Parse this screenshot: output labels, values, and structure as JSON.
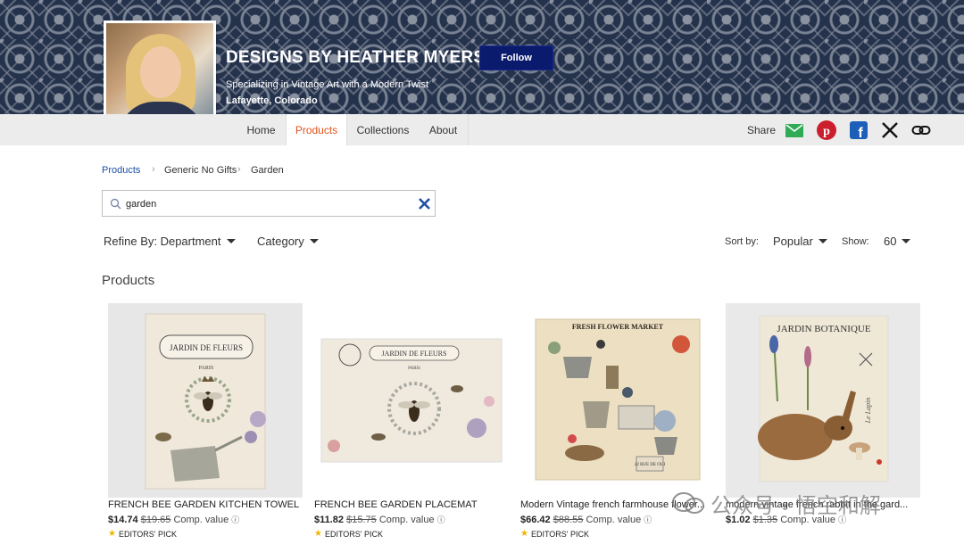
{
  "profile": {
    "shop_name": "DESIGNS BY HEATHER MYERS",
    "follow_label": "Follow",
    "tagline": "Specializing in Vintage Art with a Modern Twist",
    "location": "Lafayette, Colorado"
  },
  "nav": {
    "tabs": [
      {
        "label": "Home"
      },
      {
        "label": "Products"
      },
      {
        "label": "Collections"
      },
      {
        "label": "About"
      }
    ],
    "active": "Products",
    "share_label": "Share"
  },
  "breadcrumb": [
    "Products",
    "Generic No Gifts",
    "Garden"
  ],
  "search": {
    "value": "garden"
  },
  "filters": {
    "refine": "Refine By: Department",
    "category": "Category",
    "sort_label": "Sort by:",
    "sort_value": "Popular",
    "show_label": "Show:",
    "show_value": "60"
  },
  "section_title": "Products",
  "products": [
    {
      "title": "FRENCH BEE GARDEN KITCHEN TOWEL",
      "price": "$14.74",
      "old_price": "$19.65",
      "comp": "Comp. value",
      "badge": "EDITORS' PICK",
      "art_title": "JARDIN DE FLEURS",
      "art_sub": "PARIS"
    },
    {
      "title": "FRENCH BEE GARDEN PLACEMAT",
      "price": "$11.82",
      "old_price": "$15.75",
      "comp": "Comp. value",
      "badge": "EDITORS' PICK",
      "art_title": "JARDIN DE FLEURS",
      "art_sub": "PARIS"
    },
    {
      "title": "Modern Vintage french farmhouse flower...",
      "price": "$66.42",
      "old_price": "$88.55",
      "comp": "Comp. value",
      "badge": "EDITORS' PICK",
      "art_title": "FRESH FLOWER MARKET",
      "art_sub": "42 RUE DE OUI"
    },
    {
      "title": "modern vintage french rabbit in the gard...",
      "price": "$1.02",
      "old_price": "$1.35",
      "comp": "Comp. value",
      "badge": "",
      "art_title": "JARDIN BOTANIQUE",
      "art_sub": "Le Lapin"
    }
  ],
  "watermark": "公众号 · 悟空和解",
  "colors": {
    "accent": "#e0541d",
    "follow_bg": "#0a1b6e",
    "link": "#1a4fa3",
    "star": "#f0b400"
  }
}
